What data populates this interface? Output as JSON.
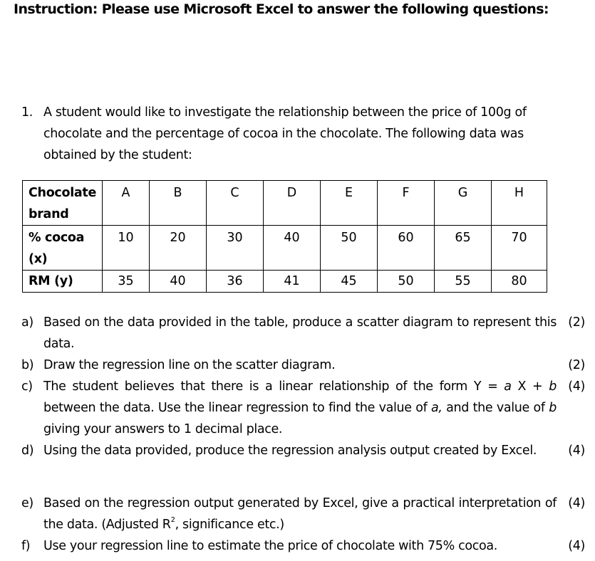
{
  "instruction": "Instruction: Please use Microsoft Excel to answer the following questions:",
  "question1": {
    "number": "1.",
    "text": "A student would like to investigate the relationship between the price of 100g of chocolate and the percentage of cocoa in the chocolate. The following data was obtained by the student:"
  },
  "table": {
    "row_headers": [
      "Chocolate brand",
      "% cocoa (x)",
      "RM (y)"
    ],
    "brands": [
      "A",
      "B",
      "C",
      "D",
      "E",
      "F",
      "G",
      "H"
    ],
    "cocoa": [
      "10",
      "20",
      "30",
      "40",
      "50",
      "60",
      "65",
      "70"
    ],
    "price": [
      "35",
      "40",
      "36",
      "41",
      "45",
      "50",
      "55",
      "80"
    ]
  },
  "subquestions": {
    "a": {
      "letter": "a)",
      "text": "Based on the data provided in the table, produce a scatter diagram to represent this data.",
      "marks": "(2)"
    },
    "b": {
      "letter": "b)",
      "text": "Draw the regression line on the scatter diagram.",
      "marks": "(2)"
    },
    "c": {
      "letter": "c)",
      "text_1": "The student believes that there is a linear relationship of the form Y = ",
      "var_a": "a",
      "text_2": " X + ",
      "var_b": "b",
      "text_3": " between the data. Use the linear regression to find the value of ",
      "var_a2": "a,",
      "text_4": " and the value of ",
      "var_b2": "b",
      "text_5": " giving your answers to 1 decimal place.",
      "marks": "(4)"
    },
    "d": {
      "letter": "d)",
      "text": "Using the data provided, produce the regression analysis output created by Excel.",
      "marks": "(4)"
    },
    "e": {
      "letter": "e)",
      "text_1": "Based on the regression output generated by Excel, give a practical interpretation of the data. (Adjusted R",
      "sup": "2",
      "text_2": ", significance etc.)",
      "marks": "(4)"
    },
    "f": {
      "letter": "f)",
      "text": "Use your regression line to estimate the price of chocolate with 75% cocoa.",
      "marks": "(4)"
    }
  }
}
